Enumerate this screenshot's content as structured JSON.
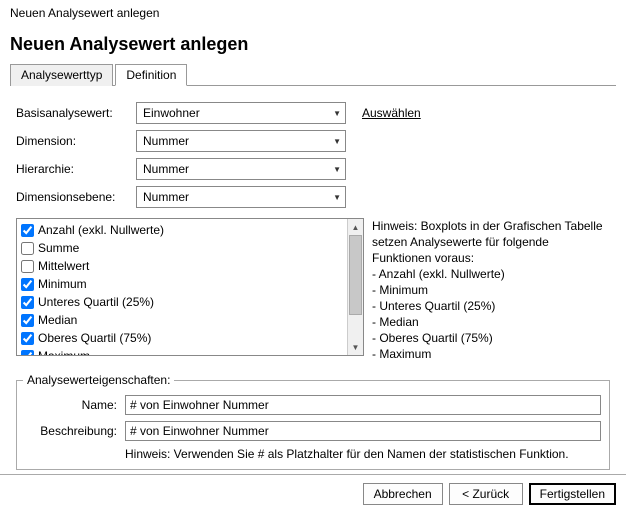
{
  "window": {
    "title": "Neuen Analysewert anlegen"
  },
  "heading": "Neuen Analysewert anlegen",
  "tabs": {
    "analysewerttyp": "Analysewerttyp",
    "definition": "Definition"
  },
  "form": {
    "basis_label": "Basisanalysewert:",
    "basis_value": "Einwohner",
    "dimension_label": "Dimension:",
    "dimension_value": "Nummer",
    "hierarchie_label": "Hierarchie:",
    "hierarchie_value": "Nummer",
    "ebene_label": "Dimensionsebene:",
    "ebene_value": "Nummer",
    "select_link": "Auswählen"
  },
  "functions": [
    {
      "label": "Anzahl (exkl. Nullwerte)",
      "checked": true
    },
    {
      "label": "Summe",
      "checked": false
    },
    {
      "label": "Mittelwert",
      "checked": false
    },
    {
      "label": "Minimum",
      "checked": true
    },
    {
      "label": "Unteres Quartil (25%)",
      "checked": true
    },
    {
      "label": "Median",
      "checked": true
    },
    {
      "label": "Oberes Quartil (75%)",
      "checked": true
    },
    {
      "label": "Maximum",
      "checked": true
    }
  ],
  "hint": {
    "intro": "Hinweis: Boxplots in der Grafischen Tabelle setzen Analysewerte für folgende Funktionen voraus:",
    "items": [
      "Anzahl (exkl. Nullwerte)",
      "Minimum",
      "Unteres Quartil (25%)",
      "Median",
      "Oberes Quartil (75%)",
      "Maximum"
    ]
  },
  "props": {
    "legend": "Analysewerteigenschaften:",
    "name_label": "Name:",
    "name_value": "# von Einwohner Nummer",
    "desc_label": "Beschreibung:",
    "desc_value": "# von Einwohner Nummer",
    "hint": "Hinweis: Verwenden Sie # als Platzhalter für den Namen der statistischen Funktion."
  },
  "buttons": {
    "cancel": "Abbrechen",
    "back": "<  Zurück",
    "finish": "Fertigstellen"
  }
}
